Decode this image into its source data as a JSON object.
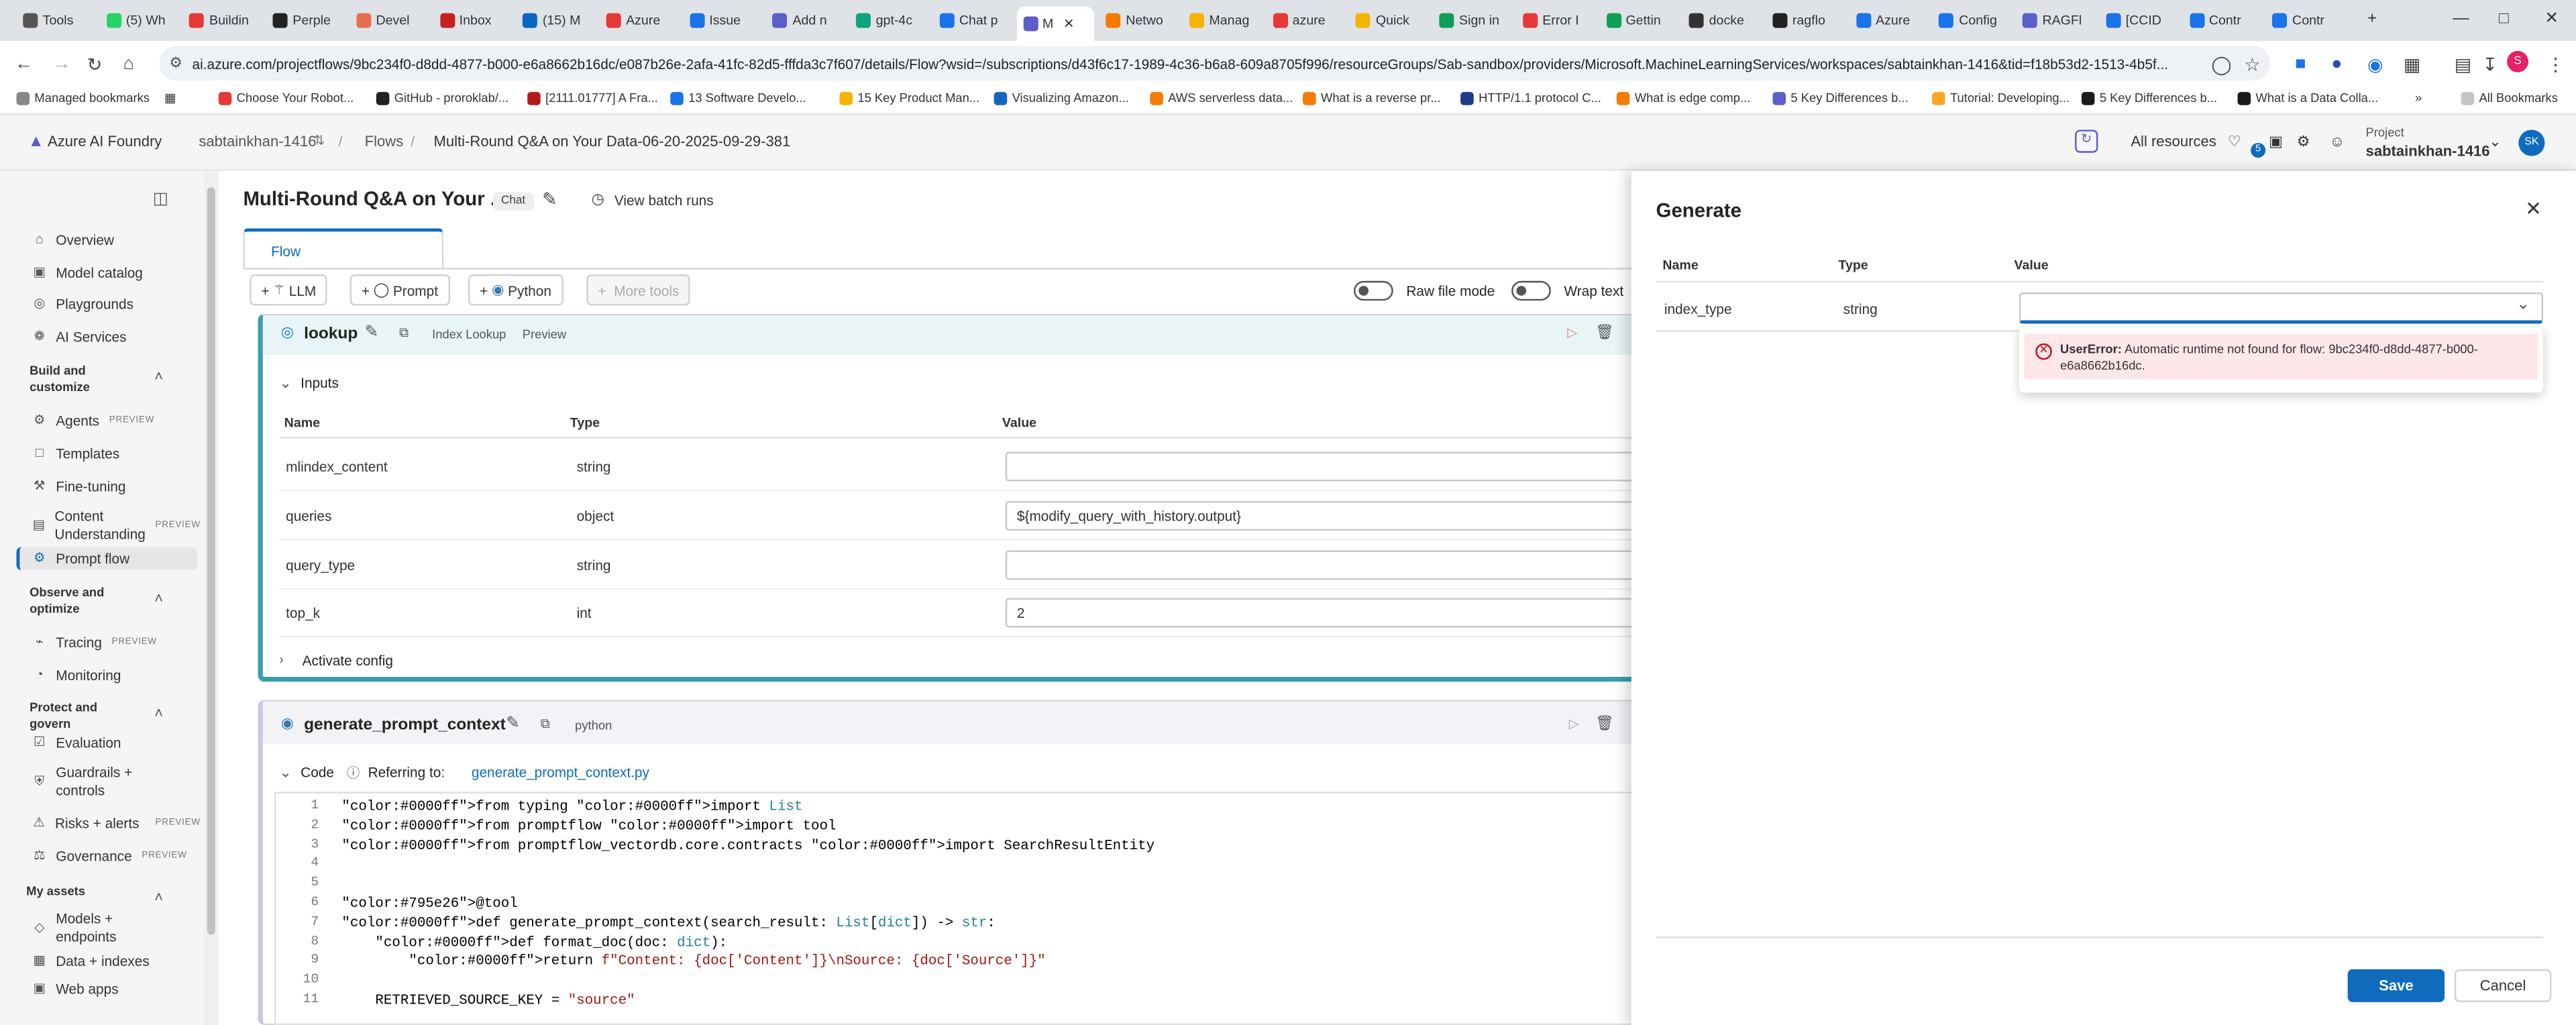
{
  "browser": {
    "tabs": [
      "Tools",
      "(5) Wh",
      "Buildin",
      "Perple",
      "Devel",
      "Inbox",
      "(15) M",
      "Azure",
      "Issue",
      "Add n",
      "gpt-4c",
      "Chat p",
      "M",
      "Netwo",
      "Manag",
      "azure",
      "Quick",
      "Sign in",
      "Error I",
      "Gettin",
      "docke",
      "ragflo",
      "Azure",
      "Config",
      "RAGFl",
      "[CCID",
      "Contr",
      "Contr"
    ],
    "url": "ai.azure.com/projectflows/9bc234f0-d8dd-4877-b000-e6a8662b16dc/e087b26e-2afa-41fc-82d5-fffda3c7f607/details/Flow?wsid=/subscriptions/d43f6c17-1989-4c36-b6a8-609a8705f996/resourceGroups/Sab-sandbox/providers/Microsoft.MachineLearningServices/workspaces/sabtainkhan-1416&tid=f18b53d2-1513-4b5f...",
    "bookmarks": [
      "Managed bookmarks",
      "Choose Your Robot...",
      "GitHub - proroklab/...",
      "[2111.01777] A Fra...",
      "13 Software Develo...",
      "15 Key Product Man...",
      "Visualizing Amazon...",
      "AWS serverless data...",
      "What is a reverse pr...",
      "HTTP/1.1 protocol C...",
      "What is edge comp...",
      "5 Key Differences b...",
      "Tutorial: Developing...",
      "5 Key Differences b...",
      "What is a Data Colla..."
    ],
    "all_bookmarks": "All Bookmarks"
  },
  "header": {
    "app_title": "Azure AI Foundry",
    "breadcrumb": [
      "sabtainkhan-1416",
      "Flows",
      "Multi-Round Q&A on Your Data-06-20-2025-09-29-381"
    ],
    "all_resources": "All resources",
    "notif_count": "5",
    "project_label": "Project",
    "project_name": "sabtainkhan-1416",
    "avatar": "SK"
  },
  "sidebar": {
    "top_items": [
      "Overview",
      "Model catalog",
      "Playgrounds",
      "AI Services"
    ],
    "sections": [
      {
        "title": "Build and customize",
        "items": [
          {
            "label": "Agents",
            "tag": "PREVIEW"
          },
          {
            "label": "Templates",
            "tag": ""
          },
          {
            "label": "Fine-tuning",
            "tag": ""
          },
          {
            "label": "Content Understanding",
            "tag": "PREVIEW"
          },
          {
            "label": "Prompt flow",
            "tag": ""
          }
        ]
      },
      {
        "title": "Observe and optimize",
        "items": [
          {
            "label": "Tracing",
            "tag": "PREVIEW"
          },
          {
            "label": "Monitoring",
            "tag": ""
          }
        ]
      },
      {
        "title": "Protect and govern",
        "items": [
          {
            "label": "Evaluation",
            "tag": ""
          },
          {
            "label": "Guardrails + controls",
            "tag": ""
          },
          {
            "label": "Risks + alerts",
            "tag": "PREVIEW"
          },
          {
            "label": "Governance",
            "tag": "PREVIEW"
          }
        ]
      },
      {
        "title": "My assets",
        "items": [
          {
            "label": "Models + endpoints",
            "tag": ""
          },
          {
            "label": "Data + indexes",
            "tag": ""
          },
          {
            "label": "Web apps",
            "tag": ""
          }
        ]
      }
    ]
  },
  "flow": {
    "title": "Multi-Round Q&A on Your ...",
    "chat_badge": "Chat",
    "view_batch_runs": "View batch runs",
    "tab_flow": "Flow",
    "toolbar": {
      "llm": "LLM",
      "prompt": "Prompt",
      "python": "Python",
      "more_tools": "More tools",
      "raw_file_mode": "Raw file mode",
      "wrap_text": "Wrap text"
    },
    "lookup": {
      "name": "lookup",
      "tag1": "Index Lookup",
      "tag2": "Preview",
      "inputs_label": "Inputs",
      "columns": [
        "Name",
        "Type",
        "Value"
      ],
      "rows": [
        {
          "name": "mlindex_content",
          "type": "string",
          "value": ""
        },
        {
          "name": "queries",
          "type": "object",
          "value": "${modify_query_with_history.output}"
        },
        {
          "name": "query_type",
          "type": "string",
          "value": ""
        },
        {
          "name": "top_k",
          "type": "int",
          "value": "2"
        }
      ],
      "activate_config": "Activate config"
    },
    "gen": {
      "name": "generate_prompt_context",
      "tag": "python",
      "code_label": "Code",
      "referring": "Referring to:",
      "file": "generate_prompt_context.py",
      "lines": [
        "from typing import List",
        "from promptflow import tool",
        "from promptflow_vectordb.core.contracts import SearchResultEntity",
        "",
        "",
        "@tool",
        "def generate_prompt_context(search_result: List[dict]) -> str:",
        "    def format_doc(doc: dict):",
        "        return f\"Content: {doc['Content']}\\nSource: {doc['Source']}\"",
        "",
        "    RETRIEVED_SOURCE_KEY = \"source\""
      ]
    }
  },
  "panel": {
    "title": "Generate",
    "columns": [
      "Name",
      "Type",
      "Value"
    ],
    "row": {
      "name": "index_type",
      "type": "string",
      "value": ""
    },
    "error_title": "UserError:",
    "error_text": "Automatic runtime not found for flow: 9bc234f0-d8dd-4877-b000-e6a8662b16dc.",
    "save": "Save",
    "cancel": "Cancel"
  },
  "colors": {
    "accent": "#0f6cbd",
    "error_bg": "#fde7e9",
    "error_icon": "#c50f1f",
    "node_border": "#3aa0a8"
  }
}
